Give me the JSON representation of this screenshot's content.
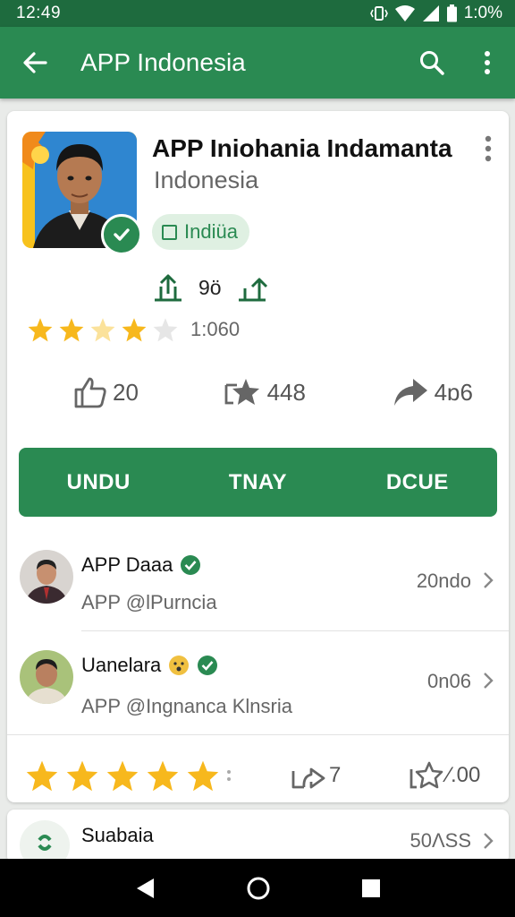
{
  "status_bar": {
    "time": "12:49",
    "battery": "1:0%"
  },
  "app_bar": {
    "title": "APP Indonesia",
    "back_icon": "arrow-left-icon",
    "search_icon": "search-icon",
    "more_icon": "more-vert-icon"
  },
  "profile": {
    "title": "APP Iniohania Indamanta",
    "subtitle": "Indonesia",
    "chip_label": "Indiüa",
    "upload_count": "9ö",
    "rating_count": "1:060",
    "rating": 4,
    "stats": {
      "likes": "20",
      "stars": "448",
      "shares": "4ɒ6"
    }
  },
  "tabs": [
    "UNDU",
    "TNAY",
    "DCUE"
  ],
  "list": [
    {
      "name": "APP Daaa",
      "handle": "APP @lPurncia",
      "meta": "20ndo"
    },
    {
      "name": "Uanelara",
      "handle": "APP @Ingnanca Klnsria",
      "meta": "0n06"
    }
  ],
  "bottom": {
    "stars": 5,
    "repost_count": "7",
    "star_count": "⁄.00"
  },
  "next_card": {
    "name": "Suabaia",
    "meta": "50ΛЅЅ"
  },
  "colors": {
    "primary": "#2a8a52",
    "primary_dark": "#1e6b3e",
    "star": "#f7b81d"
  }
}
